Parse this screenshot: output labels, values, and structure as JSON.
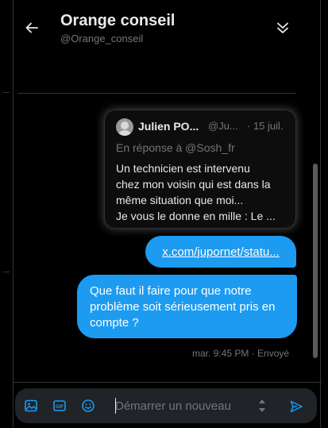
{
  "header": {
    "title": "Orange conseil",
    "handle": "@Orange_conseil",
    "back_icon": "arrow-left-icon",
    "collapse_icon": "double-chevron-down-icon"
  },
  "quoted_tweet": {
    "author_name": "Julien PO...",
    "author_handle": "@Ju...",
    "date": "· 15 juil.",
    "reply_to": "En réponse à @Sosh_fr",
    "text_lines": [
      "Un technicien est intervenu",
      "chez mon voisin qui est dans la",
      "même situation que moi...",
      "Je vous le donne en mille : Le ..."
    ]
  },
  "messages": {
    "link_text": "x.com/jupornet/statu...",
    "text_lines": [
      "Que faut il faire pour que notre",
      "problème soit sérieusement pris en",
      "compte ?"
    ],
    "meta": "mar. 9:45 PM · Envoyé"
  },
  "composer": {
    "placeholder": "Démarrer un nouveau",
    "icons": [
      "image-icon",
      "gif-icon",
      "emoji-icon",
      "send-icon"
    ]
  },
  "colors": {
    "accent": "#1d9bf0",
    "background": "#000000",
    "muted_text": "#71767b",
    "composer_bg": "#202327"
  }
}
